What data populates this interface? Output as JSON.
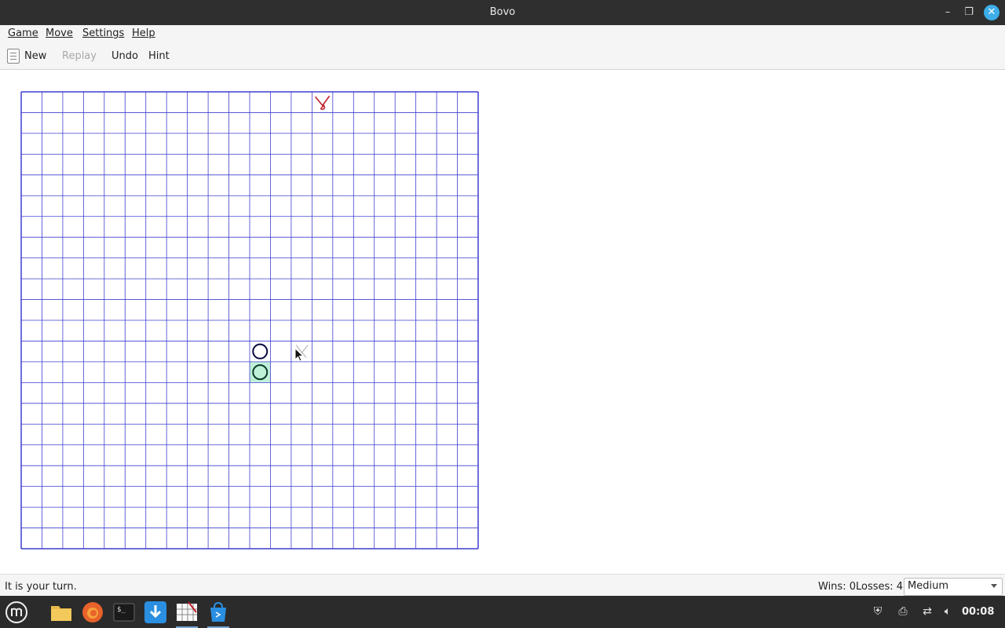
{
  "window": {
    "title": "Bovo"
  },
  "menu": {
    "game": "Game",
    "move": "Move",
    "settings": "Settings",
    "help": "Help"
  },
  "toolbar": {
    "new": "New",
    "replay": "Replay",
    "undo": "Undo",
    "hint": "Hint"
  },
  "board": {
    "size": 22,
    "grid_color": "#3f3fd0",
    "pieces": [
      {
        "player": "X",
        "col": 14,
        "row": 0,
        "color": "#c0202a",
        "style": "sketch"
      },
      {
        "player": "O",
        "col": 11,
        "row": 12,
        "color": "#0a0a40"
      },
      {
        "player": "O",
        "col": 11,
        "row": 13,
        "color": "#0a3a28",
        "highlight": "#bff0d8"
      },
      {
        "player": "X",
        "col": 13,
        "row": 12,
        "color": "#b8b8b8",
        "style": "ghost"
      }
    ]
  },
  "status": {
    "message": "It is your turn.",
    "wins": "Wins: 0",
    "losses": "Losses: 4",
    "difficulty": "Medium"
  },
  "taskbar": {
    "clock": "00:08"
  }
}
